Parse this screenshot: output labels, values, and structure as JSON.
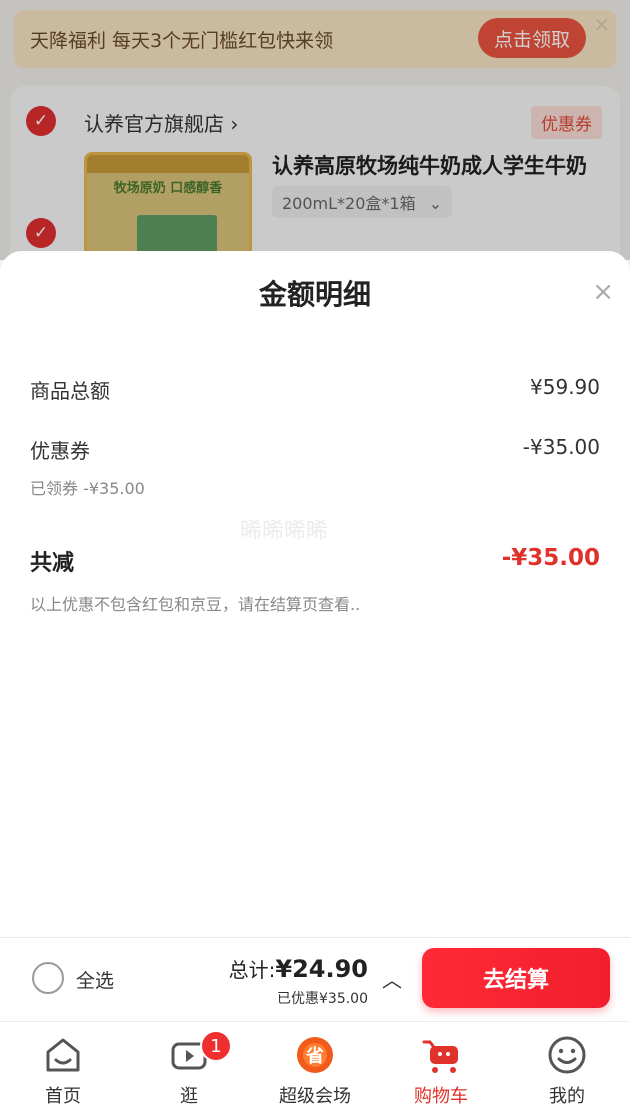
{
  "banner": {
    "text": "天降福利 每天3个无门槛红包快来领",
    "button": "点击领取",
    "close": "×"
  },
  "shop": {
    "name": "认养官方旗舰店",
    "name_arrow": "›",
    "coupon_tag": "优惠券",
    "product_title": "认养高原牧场纯牛奶成人学生牛奶",
    "spec": "200mL*20盒*1箱",
    "spec_arrow": "⌄",
    "image_text": "牧场原奶 口感醇香"
  },
  "sheet": {
    "title": "金额明细",
    "close": "×",
    "rows": [
      {
        "label": "商品总额",
        "value": "¥59.90"
      },
      {
        "label": "优惠券",
        "value": "-¥35.00",
        "sub": "已领券 -¥35.00"
      }
    ],
    "total_label": "共减",
    "total_value": "-¥35.00",
    "note": "以上优惠不包含红包和京豆，请在结算页查看..",
    "watermark": "晞晞晞晞"
  },
  "checkout": {
    "select_all": "全选",
    "total_prefix": "总计:",
    "total_amount": "¥24.90",
    "discount": "已优惠¥35.00",
    "button": "去结算",
    "chevron": "︿"
  },
  "tabs": [
    {
      "label": "首页",
      "icon": "home-icon"
    },
    {
      "label": "逛",
      "icon": "video-icon",
      "badge": "1"
    },
    {
      "label": "超级会场",
      "icon": "super-venue-icon"
    },
    {
      "label": "购物车",
      "icon": "cart-icon",
      "active": true
    },
    {
      "label": "我的",
      "icon": "smile-face-icon"
    }
  ],
  "colors": {
    "accent_red": "#e0312b",
    "promo_bg": "#f7e3c4",
    "promo_button": "#e9543f"
  }
}
